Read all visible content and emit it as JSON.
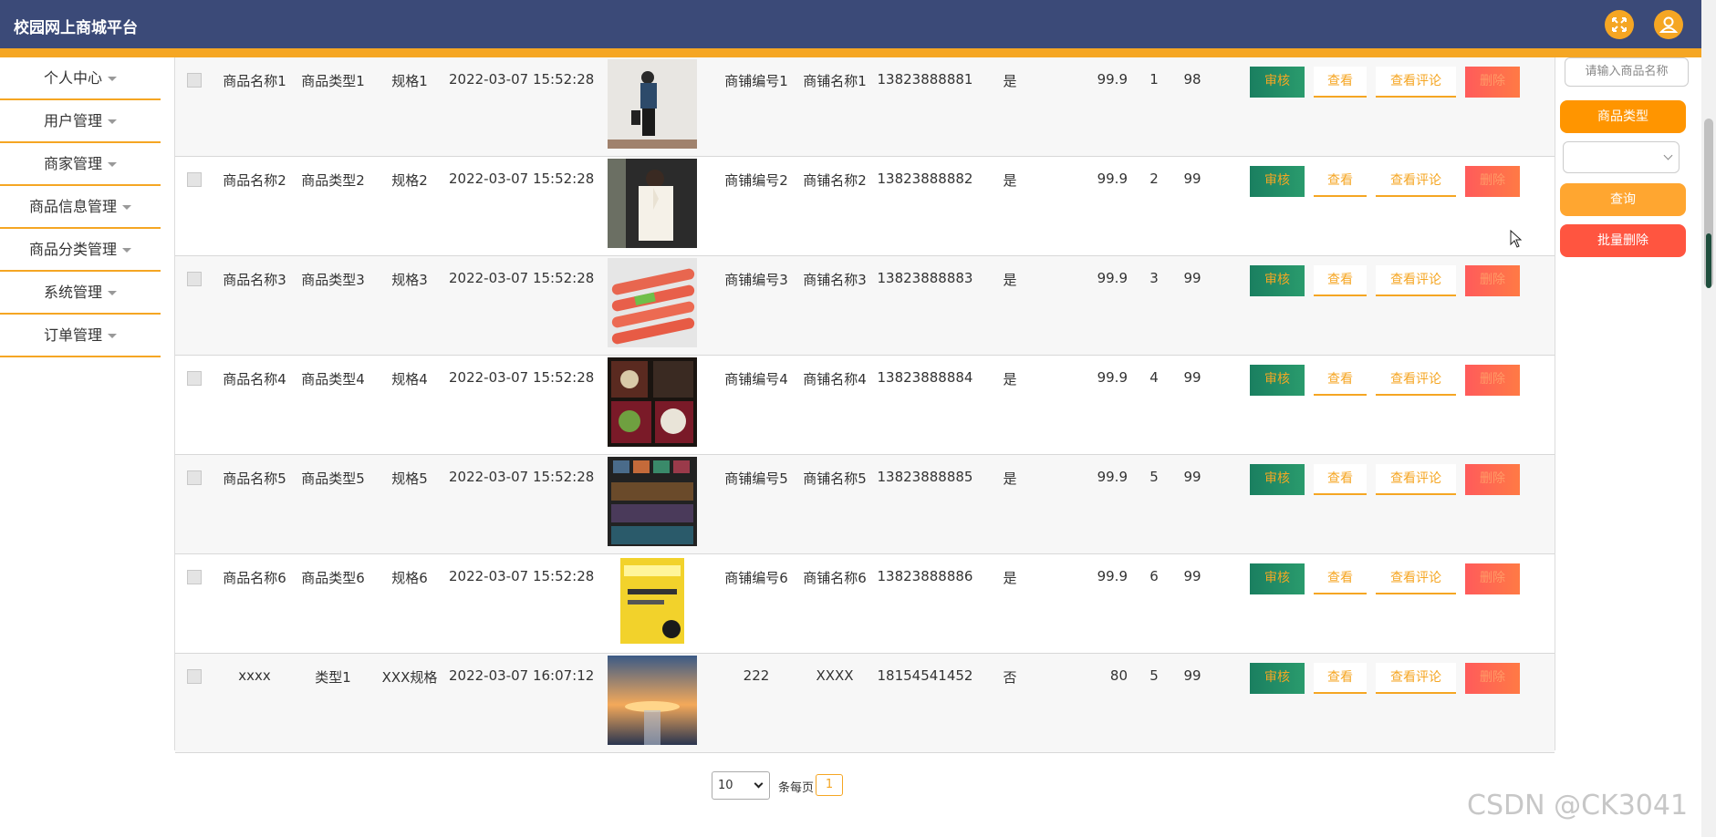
{
  "header": {
    "title": "校园网上商城平台"
  },
  "sidebar": {
    "items": [
      {
        "label": "个人中心"
      },
      {
        "label": "用户管理"
      },
      {
        "label": "商家管理"
      },
      {
        "label": "商品信息管理"
      },
      {
        "label": "商品分类管理"
      },
      {
        "label": "系统管理"
      },
      {
        "label": "订单管理"
      }
    ]
  },
  "actions": {
    "audit": "审核",
    "view": "查看",
    "review": "查看评论",
    "delete": "删除"
  },
  "rows": [
    {
      "name": "商品名称1",
      "type": "商品类型1",
      "spec": "规格1",
      "time": "2022-03-07 15:52:28",
      "shop_no": "商铺编号1",
      "shop_name": "商铺名称1",
      "phone": "13823888881",
      "flag": "是",
      "price": "99.9",
      "n1": "1",
      "n2": "98"
    },
    {
      "name": "商品名称2",
      "type": "商品类型2",
      "spec": "规格2",
      "time": "2022-03-07 15:52:28",
      "shop_no": "商铺编号2",
      "shop_name": "商铺名称2",
      "phone": "13823888882",
      "flag": "是",
      "price": "99.9",
      "n1": "2",
      "n2": "99"
    },
    {
      "name": "商品名称3",
      "type": "商品类型3",
      "spec": "规格3",
      "time": "2022-03-07 15:52:28",
      "shop_no": "商铺编号3",
      "shop_name": "商铺名称3",
      "phone": "13823888883",
      "flag": "是",
      "price": "99.9",
      "n1": "3",
      "n2": "99"
    },
    {
      "name": "商品名称4",
      "type": "商品类型4",
      "spec": "规格4",
      "time": "2022-03-07 15:52:28",
      "shop_no": "商铺编号4",
      "shop_name": "商铺名称4",
      "phone": "13823888884",
      "flag": "是",
      "price": "99.9",
      "n1": "4",
      "n2": "99"
    },
    {
      "name": "商品名称5",
      "type": "商品类型5",
      "spec": "规格5",
      "time": "2022-03-07 15:52:28",
      "shop_no": "商铺编号5",
      "shop_name": "商铺名称5",
      "phone": "13823888885",
      "flag": "是",
      "price": "99.9",
      "n1": "5",
      "n2": "99"
    },
    {
      "name": "商品名称6",
      "type": "商品类型6",
      "spec": "规格6",
      "time": "2022-03-07 15:52:28",
      "shop_no": "商铺编号6",
      "shop_name": "商铺名称6",
      "phone": "13823888886",
      "flag": "是",
      "price": "99.9",
      "n1": "6",
      "n2": "99"
    },
    {
      "name": "xxxx",
      "type": "类型1",
      "spec": "XXX规格",
      "time": "2022-03-07 16:07:12",
      "shop_no": "222",
      "shop_name": "XXXX",
      "phone": "18154541452",
      "flag": "否",
      "price": "80",
      "n1": "5",
      "n2": "99"
    }
  ],
  "rightpanel": {
    "search_placeholder": "请输入商品名称",
    "type_button": "商品类型",
    "query_button": "查询",
    "batch_delete_button": "批量删除"
  },
  "pager": {
    "page_size": "10",
    "per_page_label": "条每页",
    "current_page": "1"
  },
  "watermark": "CSDN @CK3041",
  "colors": {
    "header": "#3b4a78",
    "accent": "#f5a623",
    "audit": "#1a7f60",
    "danger": "#ff5540"
  }
}
